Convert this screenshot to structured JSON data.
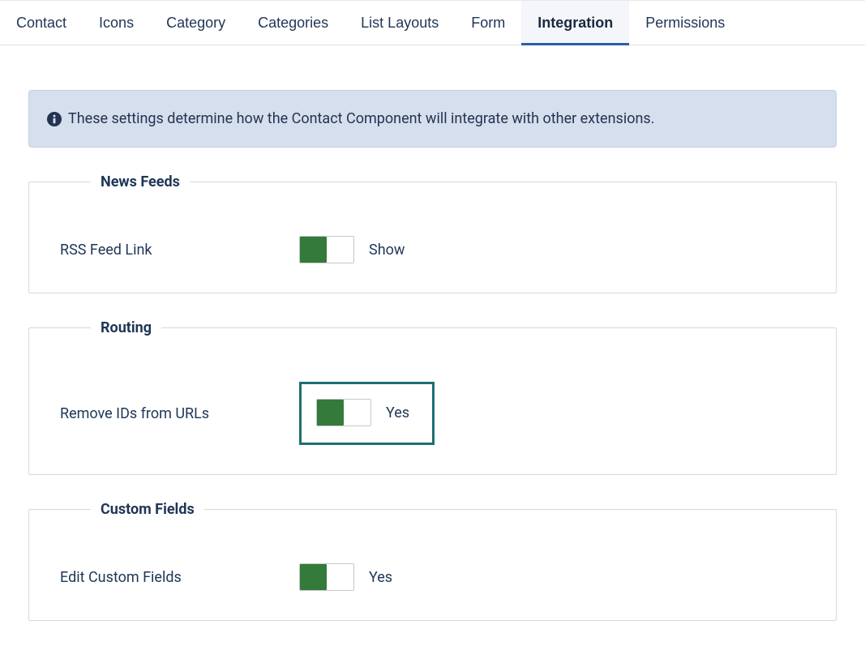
{
  "tabs": [
    {
      "label": "Contact"
    },
    {
      "label": "Icons"
    },
    {
      "label": "Category"
    },
    {
      "label": "Categories"
    },
    {
      "label": "List Layouts"
    },
    {
      "label": "Form"
    },
    {
      "label": "Integration"
    },
    {
      "label": "Permissions"
    }
  ],
  "info_message": "These settings determine how the Contact Component will integrate with other extensions.",
  "fieldsets": {
    "news_feeds": {
      "legend": "News Feeds",
      "rss_label": "RSS Feed Link",
      "rss_value": "Show"
    },
    "routing": {
      "legend": "Routing",
      "remove_ids_label": "Remove IDs from URLs",
      "remove_ids_value": "Yes"
    },
    "custom_fields": {
      "legend": "Custom Fields",
      "edit_label": "Edit Custom Fields",
      "edit_value": "Yes"
    }
  }
}
